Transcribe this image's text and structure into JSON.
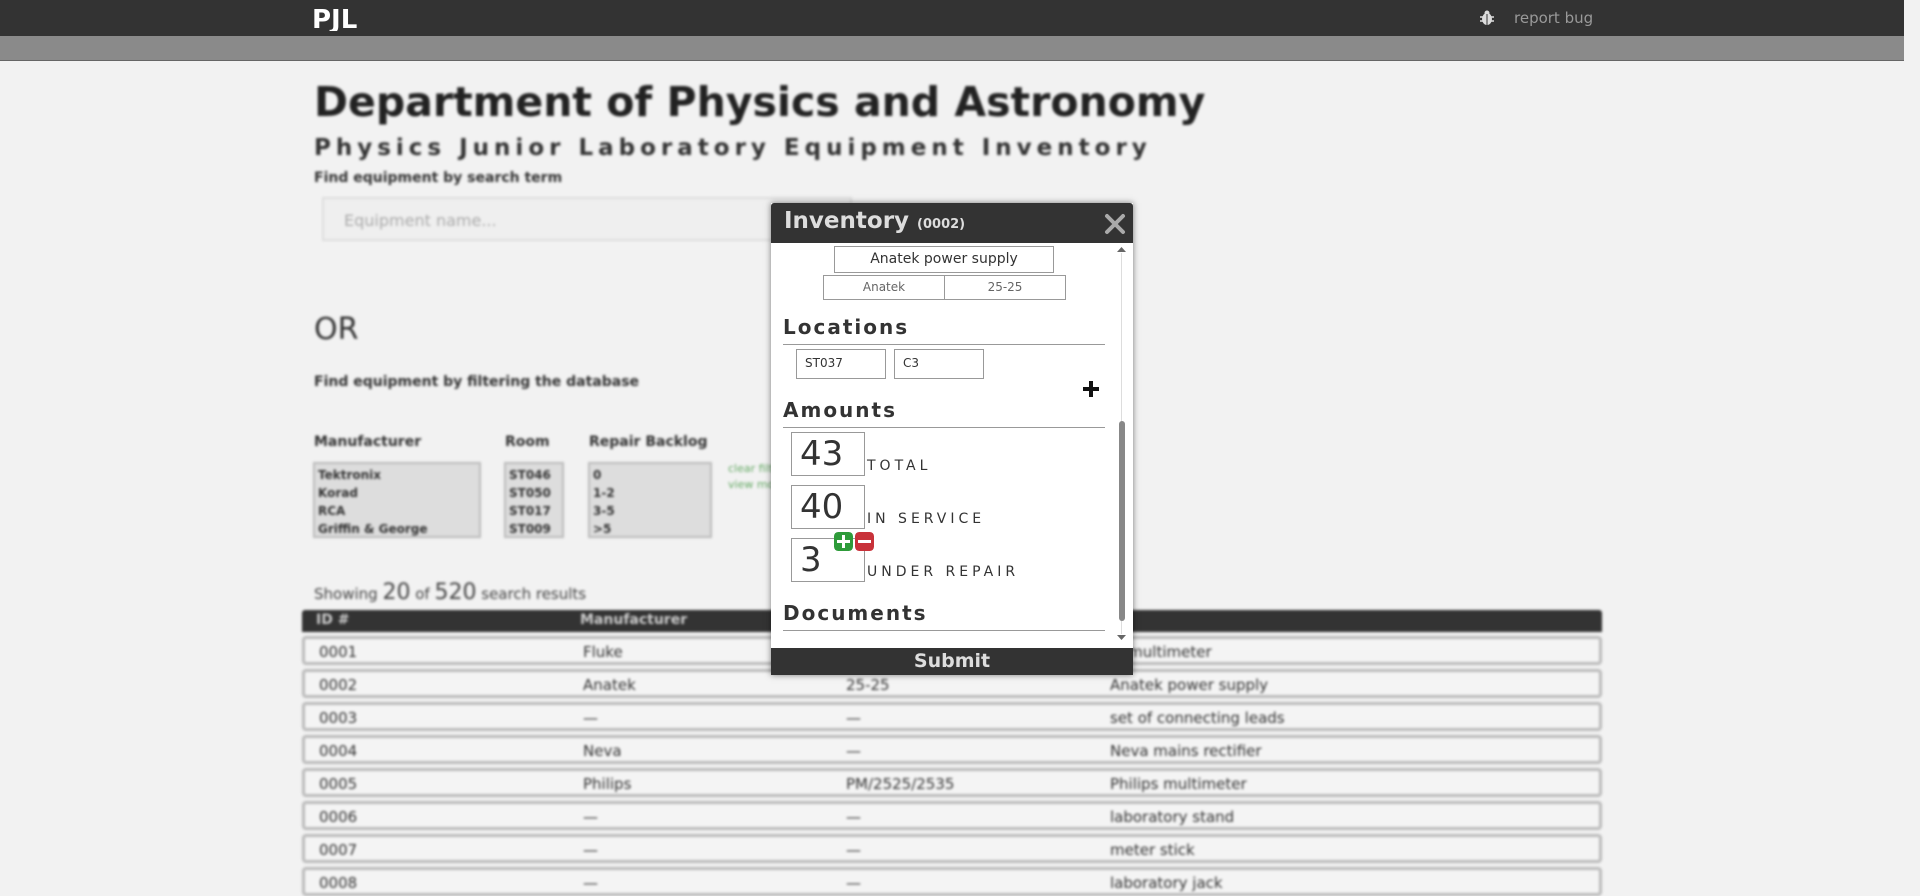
{
  "nav": {
    "logo_text": "PJL",
    "report_label": "report bug"
  },
  "page": {
    "title": "Department of Physics and Astronomy",
    "subtitle": "Physics Junior Laboratory Equipment Inventory",
    "search_label": "Find equipment by search term",
    "search_placeholder": "Equipment name...",
    "or_label": "OR",
    "filter_label": "Find equipment by filtering the database"
  },
  "filters": {
    "manufacturer": {
      "label": "Manufacturer",
      "options": [
        "Tektronix",
        "Korad",
        "RCA",
        "Griffin & George"
      ]
    },
    "room": {
      "label": "Room",
      "options": [
        "ST046",
        "ST050",
        "ST017",
        "ST009"
      ]
    },
    "repair": {
      "label": "Repair Backlog",
      "options": [
        "0",
        "1-2",
        "3-5",
        ">5"
      ]
    },
    "clear_link": "clear filt",
    "view_link": "view mo"
  },
  "results": {
    "prefix": "Showing",
    "shown": "20",
    "of": "of",
    "total": "520",
    "suffix": "search results",
    "columns": [
      "ID #",
      "Manufacturer",
      "",
      "me"
    ],
    "rows": [
      [
        "0001",
        "Fluke",
        "",
        "le multimeter"
      ],
      [
        "0002",
        "Anatek",
        "25-25",
        "Anatek power supply"
      ],
      [
        "0003",
        "—",
        "—",
        "set of connecting leads"
      ],
      [
        "0004",
        "Neva",
        "—",
        "Neva mains rectifier"
      ],
      [
        "0005",
        "Philips",
        "PM/2525/2535",
        "Philips multimeter"
      ],
      [
        "0006",
        "—",
        "—",
        "laboratory stand"
      ],
      [
        "0007",
        "—",
        "—",
        "meter stick"
      ],
      [
        "0008",
        "—",
        "—",
        "laboratory jack"
      ]
    ]
  },
  "modal": {
    "title": "Inventory",
    "id": "(0002)",
    "name": "Anatek power supply",
    "manufacturer": "Anatek",
    "model": "25-25",
    "locations_heading": "Locations",
    "location_room": "ST037",
    "location_spot": "C3",
    "amounts_heading": "Amounts",
    "total_value": "43",
    "total_label": "TOTAL",
    "in_service_value": "40",
    "in_service_label": "IN SERVICE",
    "under_repair_value": "3",
    "under_repair_label": "UNDER REPAIR",
    "documents_heading": "Documents",
    "submit_label": "Submit"
  },
  "colors": {
    "accent_plus": "#2e9b3a",
    "accent_minus": "#c8323a",
    "header_dark": "#333333"
  }
}
